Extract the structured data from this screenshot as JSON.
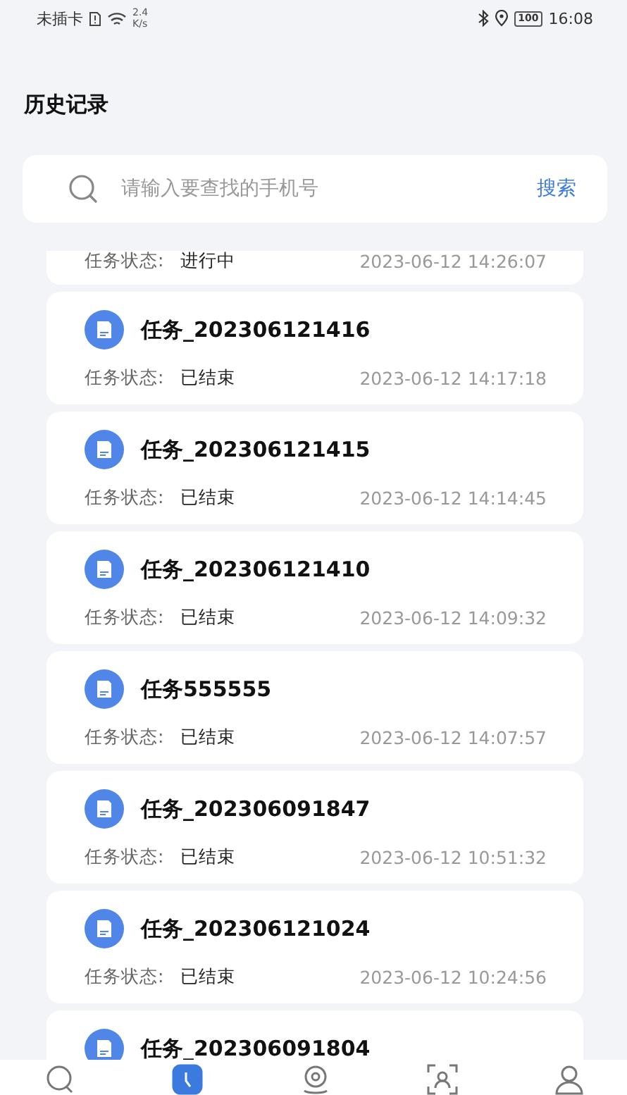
{
  "status_bar": {
    "carrier": "未插卡",
    "speed_value": "2.4",
    "speed_unit": "K/s",
    "battery": "100",
    "time": "16:08"
  },
  "title": "历史记录",
  "search": {
    "placeholder": "请输入要查找的手机号",
    "button": "搜索"
  },
  "tasks": [
    {
      "status_label": "任务状态:",
      "status": "进行中",
      "time": "2023-06-12 14:26:07"
    },
    {
      "title": "任务_202306121416",
      "status_label": "任务状态:",
      "status": "已结束",
      "time": "2023-06-12 14:17:18"
    },
    {
      "title": "任务_202306121415",
      "status_label": "任务状态:",
      "status": "已结束",
      "time": "2023-06-12 14:14:45"
    },
    {
      "title": "任务_202306121410",
      "status_label": "任务状态:",
      "status": "已结束",
      "time": "2023-06-12 14:09:32"
    },
    {
      "title": "任务555555",
      "status_label": "任务状态:",
      "status": "已结束",
      "time": "2023-06-12 14:07:57"
    },
    {
      "title": "任务_202306091847",
      "status_label": "任务状态:",
      "status": "已结束",
      "time": "2023-06-12 10:51:32"
    },
    {
      "title": "任务_202306121024",
      "status_label": "任务状态:",
      "status": "已结束",
      "time": "2023-06-12 10:24:56"
    },
    {
      "title": "任务_202306091804"
    }
  ],
  "tab_bar": [
    {
      "kind": "search",
      "selected": false
    },
    {
      "kind": "history",
      "selected": true
    },
    {
      "kind": "location",
      "selected": false
    },
    {
      "kind": "scan",
      "selected": false
    },
    {
      "kind": "profile",
      "selected": false
    }
  ]
}
